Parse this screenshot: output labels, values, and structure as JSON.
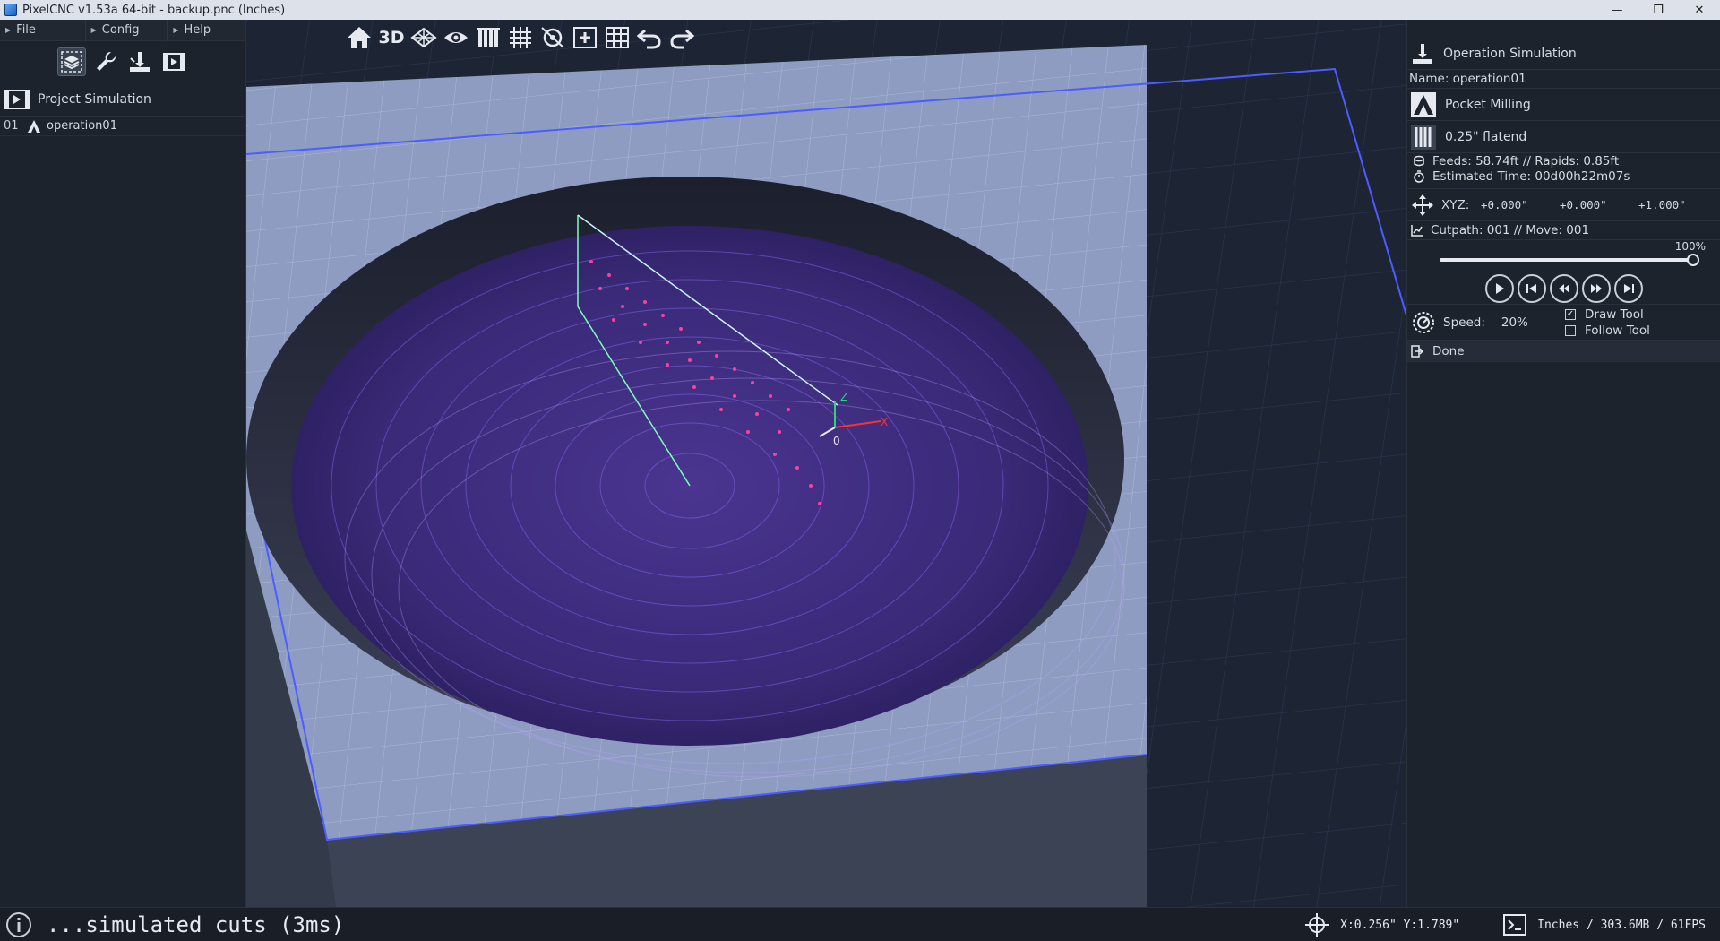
{
  "window": {
    "title": "PixelCNC v1.53a 64-bit  - backup.pnc (Inches)",
    "minimize": "—",
    "restore": "❐",
    "close": "✕"
  },
  "menu": {
    "file": "File",
    "config": "Config",
    "help": "Help"
  },
  "project": {
    "header": "Project Simulation",
    "operations": [
      {
        "num": "01",
        "name": "operation01"
      }
    ]
  },
  "view_toolbar": {
    "mode_3d": "3D"
  },
  "viewport": {
    "origin_label": "0",
    "axis_z": "Z",
    "axis_x": "X"
  },
  "simulation": {
    "header": "Operation Simulation",
    "name_line": "Name: operation01",
    "operation_type": "Pocket Milling",
    "tool": "0.25\" flatend",
    "feeds_line": "Feeds: 58.74ft  //  Rapids: 0.85ft",
    "estimated_time": "Estimated Time: 00d00h22m07s",
    "xyz_label": "XYZ:",
    "x": "+0.000\"",
    "y": "+0.000\"",
    "z": "+1.000\"",
    "cutpath_line": "Cutpath: 001  //  Move: 001",
    "progress_label": "100%",
    "progress": 1.0,
    "speed_label": "Speed:",
    "speed_value": "20%",
    "draw_tool_label": "Draw Tool",
    "draw_tool_checked": "✓",
    "follow_tool_label": "Follow Tool",
    "done_label": "Done"
  },
  "status": {
    "message": "...simulated cuts (3ms)",
    "coords": "X:0.256\" Y:1.789\"",
    "units_info": "Inches / 303.6MB / 61FPS"
  },
  "colors": {
    "stock": "#8f9ec3",
    "pocket": "#3a2870",
    "toolpath": "#ff3fa0",
    "accent": "#4d5cff"
  }
}
